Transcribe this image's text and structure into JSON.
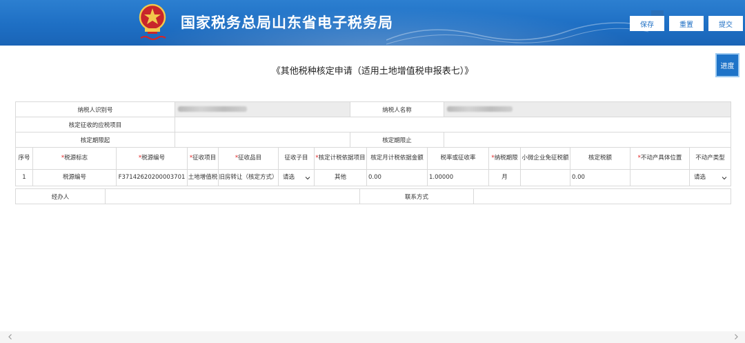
{
  "header": {
    "site_title": "国家税务总局山东省电子税务局",
    "buttons": {
      "save": "保存",
      "reset": "重置",
      "submit": "提交"
    }
  },
  "page": {
    "title": "《其他税种核定申请（适用土地增值税申报表七）》",
    "progress_label": "进度"
  },
  "form": {
    "taxpayer_id_label": "纳税人识别号",
    "taxpayer_name_label": "纳税人名称",
    "tax_items_label": "核定征收的应税项目",
    "period_start_label": "核定期限起",
    "period_end_label": "核定期限止"
  },
  "grid": {
    "columns": [
      {
        "label": "序号",
        "required": false
      },
      {
        "label": "税源标志",
        "required": true
      },
      {
        "label": "税源编号",
        "required": true
      },
      {
        "label": "征收项目",
        "required": true
      },
      {
        "label": "征收品目",
        "required": true
      },
      {
        "label": "征收子目",
        "required": false
      },
      {
        "label": "核定计税依据项目",
        "required": true
      },
      {
        "label": "核定月计税依据金额",
        "required": false
      },
      {
        "label": "税率或征收率",
        "required": false
      },
      {
        "label": "纳税期限",
        "required": true
      },
      {
        "label": "小微企业免征税额",
        "required": false
      },
      {
        "label": "核定税额",
        "required": false
      },
      {
        "label": "不动产具体位置",
        "required": true
      },
      {
        "label": "不动产类型",
        "required": false
      }
    ],
    "rows": [
      {
        "index": "1",
        "source_flag": "税源编号",
        "source_no": "F37142620200003701",
        "levy_item": "土地增值税",
        "levy_category": "旧房转让（核定方式）",
        "levy_subitem": "请选",
        "basis_item": "其他",
        "monthly_amount": "0.00",
        "tax_rate": "1.00000",
        "period": "月",
        "sme_exempt": "",
        "assessed_tax": "0.00",
        "property_location": "",
        "property_type": "请选"
      }
    ]
  },
  "footer": {
    "handler_label": "经办人",
    "contact_label": "联系方式"
  }
}
